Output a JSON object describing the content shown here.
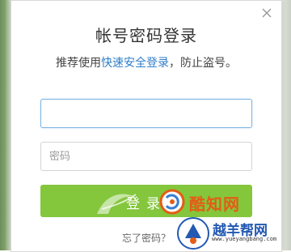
{
  "dialog": {
    "title": "帐号密码登录",
    "subtitle_prefix": "推荐使用",
    "subtitle_link": "快速安全登录",
    "subtitle_suffix": "，防止盗号。",
    "account": {
      "value": "",
      "placeholder": ""
    },
    "password": {
      "value": "",
      "placeholder": "密码"
    },
    "login_label": "登录",
    "forgot_text": "忘了密码？",
    "close_icon": "close-icon"
  },
  "watermarks": {
    "kuzhiwang": "酷知网",
    "yueyangbang_title": "越羊帮网",
    "yueyangbang_url": "www.yueyangbang.com"
  },
  "colors": {
    "link": "#2f7ec9",
    "login_button": "#84c63c",
    "focus_border": "#7fb5e3",
    "watermark_orange": "#e35d15",
    "watermark_blue": "#2259b3"
  }
}
